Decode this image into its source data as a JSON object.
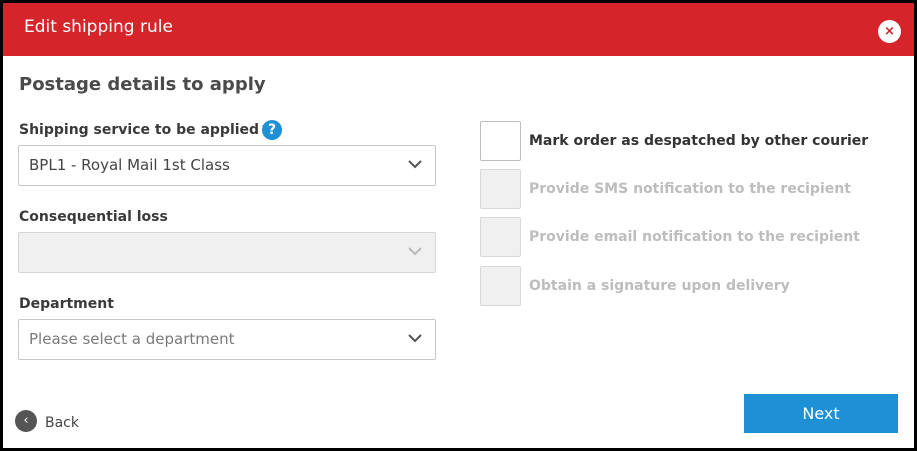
{
  "header": {
    "title": "Edit shipping rule",
    "close_icon": "×"
  },
  "section": {
    "title": "Postage details to apply"
  },
  "fields": {
    "shipping_service": {
      "label": "Shipping service to be applied",
      "required_marker": "*",
      "help_icon": "?",
      "value": "BPL1 - Royal Mail 1st Class"
    },
    "consequential_loss": {
      "label": "Consequential loss",
      "value": ""
    },
    "department": {
      "label": "Department",
      "placeholder": "Please select a department"
    }
  },
  "options": [
    {
      "label": "Mark order as despatched by other courier",
      "enabled": true,
      "checked": false
    },
    {
      "label": "Provide SMS notification to the recipient",
      "enabled": false,
      "checked": false
    },
    {
      "label": "Provide email notification to the recipient",
      "enabled": false,
      "checked": false
    },
    {
      "label": "Obtain a signature upon delivery",
      "enabled": false,
      "checked": false
    }
  ],
  "footer": {
    "back_label": "Back",
    "back_icon": "‹",
    "next_label": "Next"
  },
  "colors": {
    "header_bg": "#d6242b",
    "primary_button": "#1e90d6",
    "help_icon": "#1e90d6",
    "required_marker": "#d6242b"
  }
}
